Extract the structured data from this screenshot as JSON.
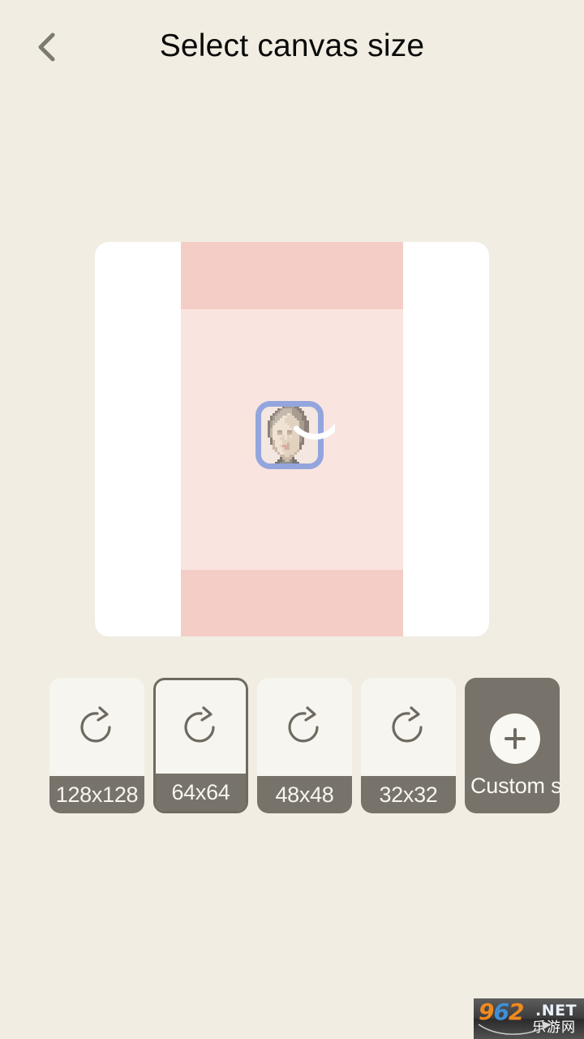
{
  "header": {
    "title": "Select canvas size",
    "back_icon": "chevron-left-icon"
  },
  "preview": {
    "avatar_icon": "pixel-art-face-avatar",
    "spinner_icon": "loading-arc-spinner",
    "colors": {
      "card_bg": "#ffffff",
      "strip_dark": "#f4cec6",
      "strip_light": "#fae4e0",
      "avatar_frame": "#93a5dd"
    }
  },
  "sizes": {
    "options": [
      {
        "label": "128x128",
        "icon": "rotate-cw-icon",
        "selected": false
      },
      {
        "label": "64x64",
        "icon": "rotate-cw-icon",
        "selected": true
      },
      {
        "label": "48x48",
        "icon": "rotate-cw-icon",
        "selected": false
      },
      {
        "label": "32x32",
        "icon": "rotate-cw-icon",
        "selected": false
      }
    ],
    "custom": {
      "label": "Custom size",
      "icon": "plus-icon"
    }
  },
  "watermark": {
    "digit_9": "9",
    "digit_6": "6",
    "digit_2": "2",
    "net": ".NET",
    "cn": "乐游网"
  },
  "theme": {
    "background": "#f1ede2",
    "accent_dark": "#77736a",
    "selected_border": "#6e6a60",
    "button_bg": "#f7f5ef",
    "title_color": "#0a0a0a"
  }
}
